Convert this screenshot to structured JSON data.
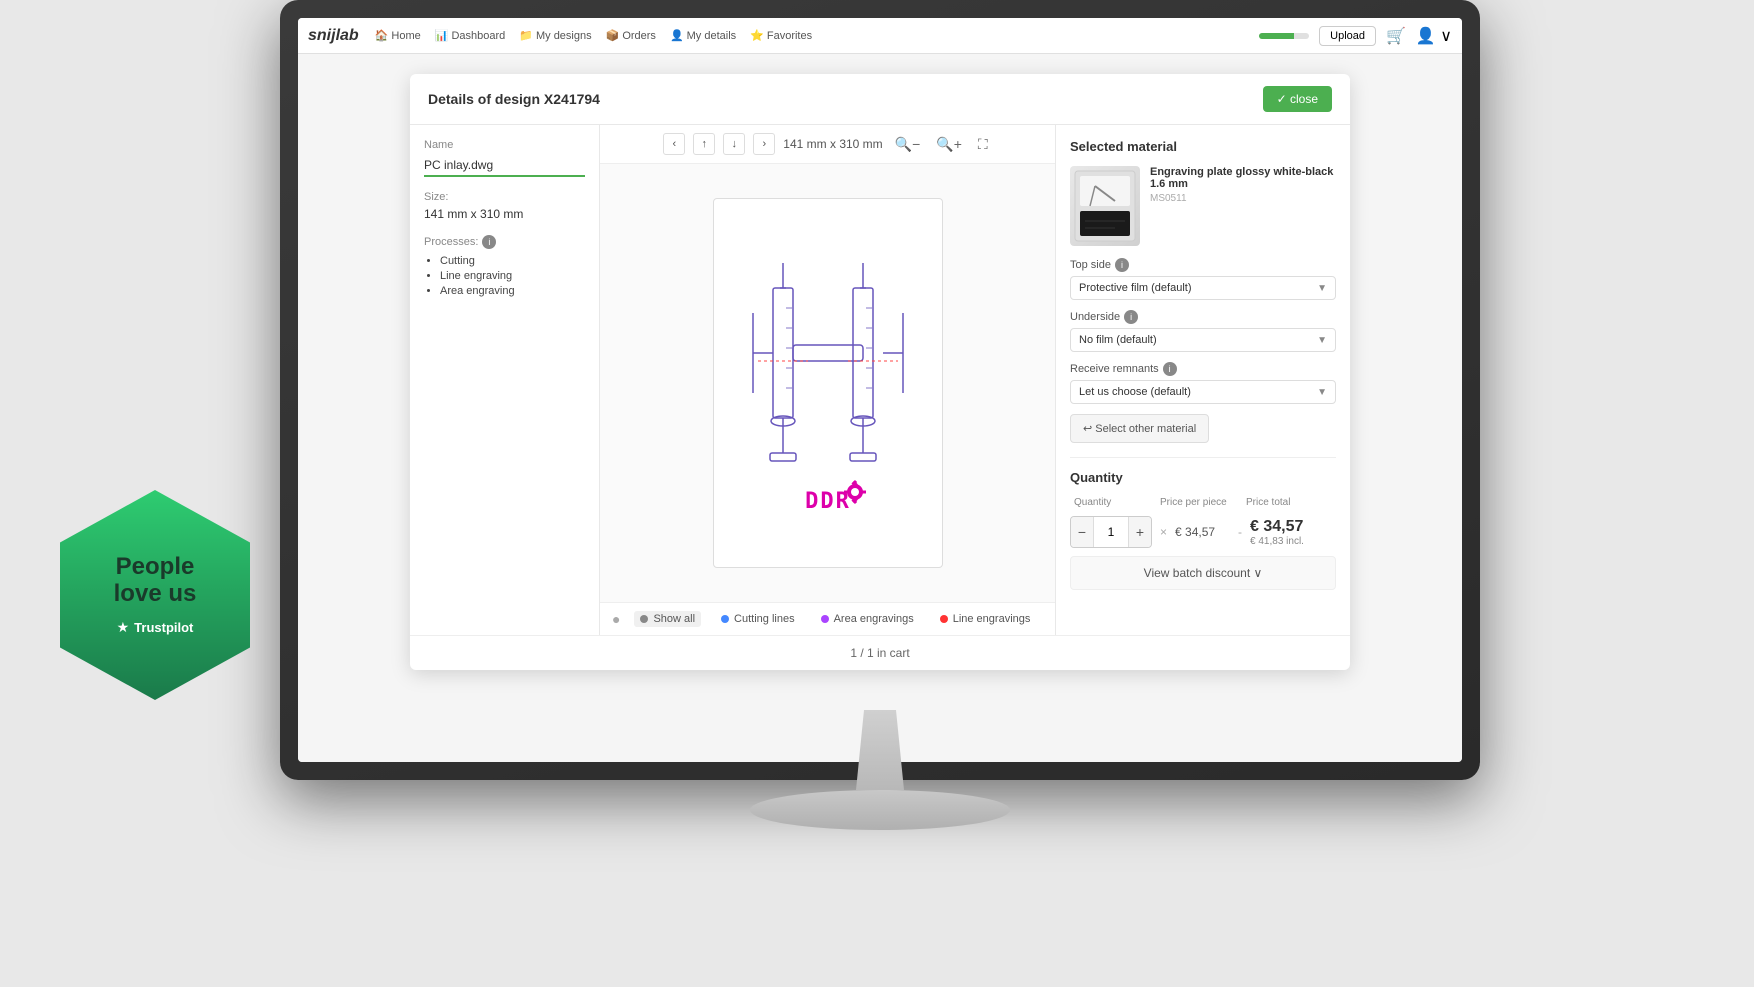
{
  "nav": {
    "logo": "snijlab",
    "items": [
      {
        "label": "Home",
        "icon": "🏠"
      },
      {
        "label": "Dashboard",
        "icon": "📊"
      },
      {
        "label": "My designs",
        "icon": "📁"
      },
      {
        "label": "Orders",
        "icon": "📦"
      },
      {
        "label": "My details",
        "icon": "👤"
      },
      {
        "label": "Favorites",
        "icon": "⭐"
      }
    ],
    "upload_label": "Upload",
    "progress_pct": 70
  },
  "dialog": {
    "title": "Details of design X241794",
    "close_label": "✓ close"
  },
  "left_panel": {
    "name_label": "Name",
    "name_value": "PC inlay.dwg",
    "size_label": "Size:",
    "size_value": "141 mm x 310 mm",
    "processes_label": "Processes:",
    "processes": [
      "Cutting",
      "Line engraving",
      "Area engraving"
    ]
  },
  "viewer": {
    "size_display": "141 mm x 310 mm",
    "zoom_in_label": "+",
    "zoom_out_label": "-",
    "expand_label": "⛶",
    "nav_prev": "‹",
    "nav_up": "↑",
    "nav_down": "↓",
    "nav_next": "›",
    "filters": [
      {
        "label": "Show all",
        "color": "#888",
        "active": true
      },
      {
        "label": "Cutting lines",
        "color": "#4488ff"
      },
      {
        "label": "Area engravings",
        "color": "#aa44ff"
      },
      {
        "label": "Line engravings",
        "color": "#ff3333"
      }
    ]
  },
  "right_panel": {
    "section_title": "Selected material",
    "material_name": "Engraving plate glossy white-black 1.6 mm",
    "material_code": "MS0511",
    "top_side_label": "Top side",
    "top_side_value": "Protective film (default)",
    "underside_label": "Underside",
    "underside_value": "No film (default)",
    "receive_remnants_label": "Receive remnants",
    "receive_remnants_value": "Let us choose (default)",
    "select_other_label": "↩ Select other material",
    "quantity_section_title": "Quantity",
    "col_quantity": "Quantity",
    "col_price_per_piece": "Price per piece",
    "col_price_total": "Price total",
    "qty_value": "1",
    "price_per_piece": "€ 34,57",
    "price_total": "€ 34,57",
    "price_incl": "€ 41,83 incl.",
    "batch_discount_label": "View batch discount ∨"
  },
  "footer": {
    "cart_text": "1 / 1 in cart"
  },
  "trustpilot": {
    "line1": "People",
    "line2": "love us",
    "brand": "Trustpilot"
  }
}
